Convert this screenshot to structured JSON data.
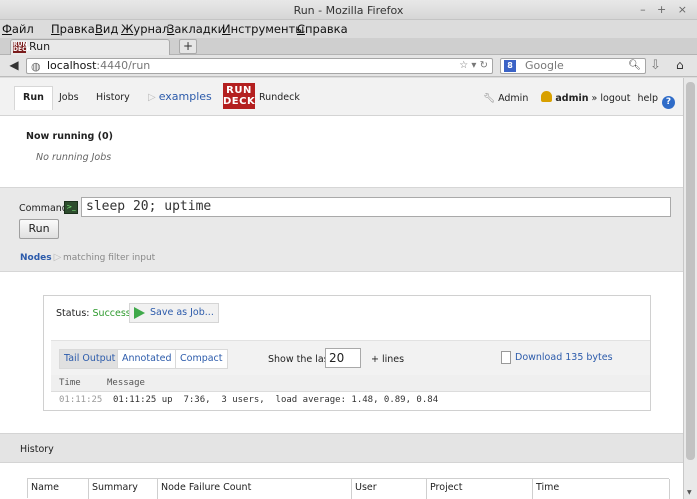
{
  "window": {
    "title": "Run - Mozilla Firefox",
    "controls": "– + ×"
  },
  "menu": [
    {
      "label": "Файл",
      "accel": "Ф",
      "rest": "айл"
    },
    {
      "label": "Правка",
      "accel": "П",
      "rest": "равка"
    },
    {
      "label": "Вид",
      "accel": "В",
      "rest": "ид"
    },
    {
      "label": "Журнал",
      "accel": "Ж",
      "rest": "урнал"
    },
    {
      "label": "Закладки",
      "accel": "З",
      "rest": "акладки"
    },
    {
      "label": "Инструменты",
      "accel": "И",
      "rest": "нструменты"
    },
    {
      "label": "Справка",
      "accel": "С",
      "rest": "правка"
    }
  ],
  "tab": {
    "title": "Run",
    "new_tab": "+"
  },
  "address": {
    "host": "localhost",
    "path": ":4440/run"
  },
  "search": {
    "placeholder": "Google"
  },
  "rundeck": {
    "nav": {
      "run": "Run",
      "jobs": "Jobs",
      "history": "History",
      "project": "examples",
      "logo_line1": "RUN",
      "logo_line2": "DECK",
      "brand": "Rundeck"
    },
    "user": {
      "admin_link": "Admin",
      "username": "admin",
      "logout": "» logout",
      "help": "help",
      "help_glyph": "?"
    },
    "now_running": {
      "title": "Now running (0)",
      "empty": "No running Jobs"
    },
    "command": {
      "label": "Command:",
      "value": "sleep 20; uptime",
      "run_button": "Run"
    },
    "nodes": {
      "label": "Nodes",
      "filter": "matching filter input"
    },
    "result": {
      "status_label": "Status:",
      "status_value": "Successful",
      "save_as_job": "Save as Job...",
      "tabs": [
        "Tail Output",
        "Annotated",
        "Compact"
      ],
      "active_tab": "Tail Output",
      "show_last_label": "Show the last -",
      "lines_value": "20",
      "lines_suffix": "+ lines",
      "download": "Download 135 bytes",
      "log_headers": {
        "time": "Time",
        "message": "Message"
      },
      "log_rows": [
        {
          "time": "01:11:25",
          "message": "01:11:25 up  7:36,  3 users,  load average: 1.48, 0.89, 0.84"
        }
      ]
    },
    "history": {
      "title": "History",
      "columns": [
        "Name",
        "Summary",
        "Node Failure Count",
        "User",
        "Project",
        "Time"
      ]
    }
  },
  "colors": {
    "success": "#2e9a2e",
    "link": "#2c5bab",
    "logo": "#b41f1f"
  }
}
